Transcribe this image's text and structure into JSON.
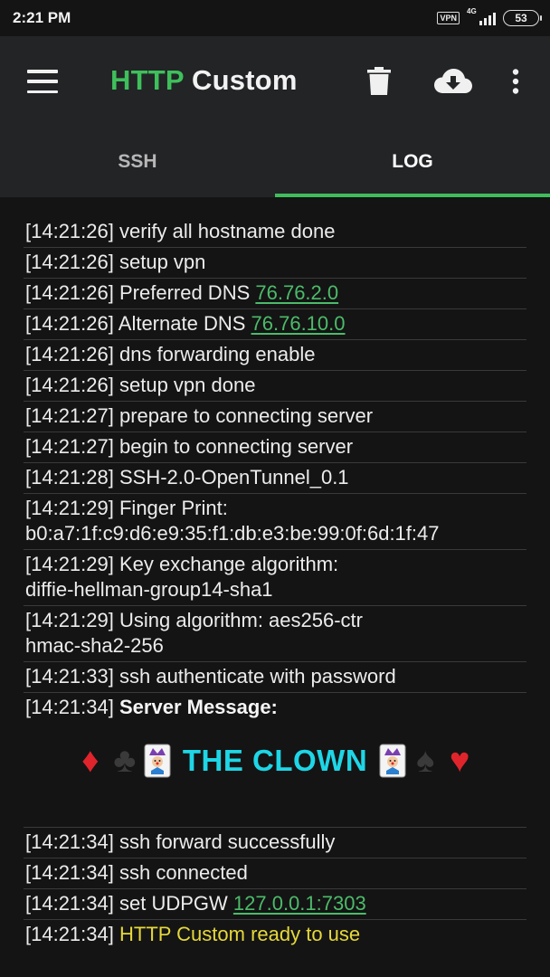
{
  "status": {
    "time": "2:21 PM",
    "vpn": "VPN",
    "network": "4G",
    "battery": "53"
  },
  "app": {
    "title_part1": "HTTP",
    "title_part2": " Custom"
  },
  "tabs": [
    {
      "label": "SSH",
      "active": false
    },
    {
      "label": "LOG",
      "active": true
    }
  ],
  "colors": {
    "accent": "#3fbf5c",
    "link": "#4cbb6a",
    "ready": "#e6d83a",
    "clown": "#1ed6e6",
    "background": "#141414",
    "appbar": "#222426"
  },
  "icons": {
    "menu": "menu-icon",
    "delete": "trash-icon",
    "download": "cloud-download-icon",
    "more": "more-vert-icon"
  },
  "log": [
    {
      "ts": "[14:21:26]",
      "text": " verify all hostname done"
    },
    {
      "ts": "[14:21:26]",
      "text": " setup vpn"
    },
    {
      "ts": "[14:21:26]",
      "text": " Preferred DNS ",
      "value": "76.76.2.0"
    },
    {
      "ts": "[14:21:26]",
      "text": " Alternate DNS ",
      "value": "76.76.10.0"
    },
    {
      "ts": "[14:21:26]",
      "text": " dns forwarding enable"
    },
    {
      "ts": "[14:21:26]",
      "text": " setup vpn done"
    },
    {
      "ts": "[14:21:27]",
      "text": " prepare to connecting server"
    },
    {
      "ts": "[14:21:27]",
      "text": " begin to connecting server"
    },
    {
      "ts": "[14:21:28]",
      "text": " SSH-2.0-OpenTunnel_0.1"
    },
    {
      "ts": "[14:21:29]",
      "text": " Finger Print:",
      "line2": "b0:a7:1f:c9:d6:e9:35:f1:db:e3:be:99:0f:6d:1f:47"
    },
    {
      "ts": "[14:21:29]",
      "text": " Key exchange algorithm:",
      "line2": "diffie-hellman-group14-sha1"
    },
    {
      "ts": "[14:21:29]",
      "text": " Using algorithm: aes256-ctr",
      "line2": "hmac-sha2-256"
    },
    {
      "ts": "[14:21:33]",
      "text": " ssh authenticate with password"
    },
    {
      "ts": "[14:21:34]",
      "text": " ",
      "bold": "Server Message:"
    },
    {
      "ts": "[14:21:34]",
      "text": " ssh forward successfully"
    },
    {
      "ts": "[14:21:34]",
      "text": " ssh connected"
    },
    {
      "ts": "[14:21:34]",
      "text": " set UDPGW ",
      "value": "127.0.0.1:7303"
    },
    {
      "ts": "[14:21:34]",
      "text": " ",
      "ready": "HTTP Custom ready to use"
    }
  ],
  "server_message": {
    "text": "THE CLOWN",
    "suits": [
      "♦",
      "♣",
      "♠",
      "♥"
    ]
  }
}
